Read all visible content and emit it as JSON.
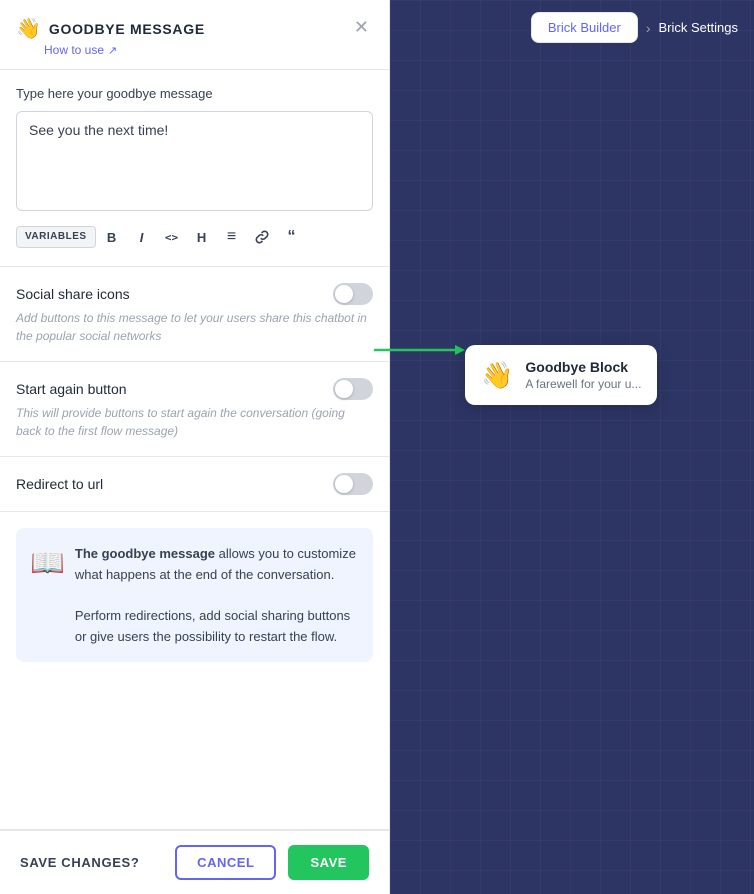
{
  "header": {
    "emoji": "👋",
    "title": "GOODBYE MESSAGE",
    "subtitle_link": "How to use",
    "external_icon": "↗"
  },
  "message_section": {
    "label": "Type here your goodbye message",
    "placeholder": "See you the next time!",
    "current_value": "See you the next time!",
    "toolbar": {
      "variables_label": "VARIABLES",
      "bold_label": "B",
      "italic_label": "I",
      "code_label": "<>",
      "heading_label": "H",
      "list_label": "≡",
      "link_label": "🔗",
      "quote_label": "❝"
    }
  },
  "social_share": {
    "title": "Social share icons",
    "description": "Add buttons to this message to let your users share this chatbot in the popular social networks",
    "enabled": false
  },
  "start_again": {
    "title": "Start again button",
    "description": "This will provide buttons to start again the conversation (going back to the first flow message)",
    "enabled": false
  },
  "redirect": {
    "title": "Redirect to url",
    "enabled": false
  },
  "info_box": {
    "icon": "📖",
    "text_part1": "The goodbye message",
    "text_part2": " allows you to customize what happens at the end of the conversation.",
    "text_part3": "Perform redirections, add social sharing buttons or give users the possibility to restart the flow."
  },
  "footer": {
    "label": "SAVE CHANGES?",
    "cancel_label": "CANCEL",
    "save_label": "SAVE"
  },
  "right_panel": {
    "brick_builder_label": "Brick Builder",
    "breadcrumb_sep": "›",
    "brick_settings_label": "Brick Settings",
    "card": {
      "emoji": "👋",
      "title": "Goodbye Block",
      "subtitle": "A farewell for your u..."
    }
  }
}
